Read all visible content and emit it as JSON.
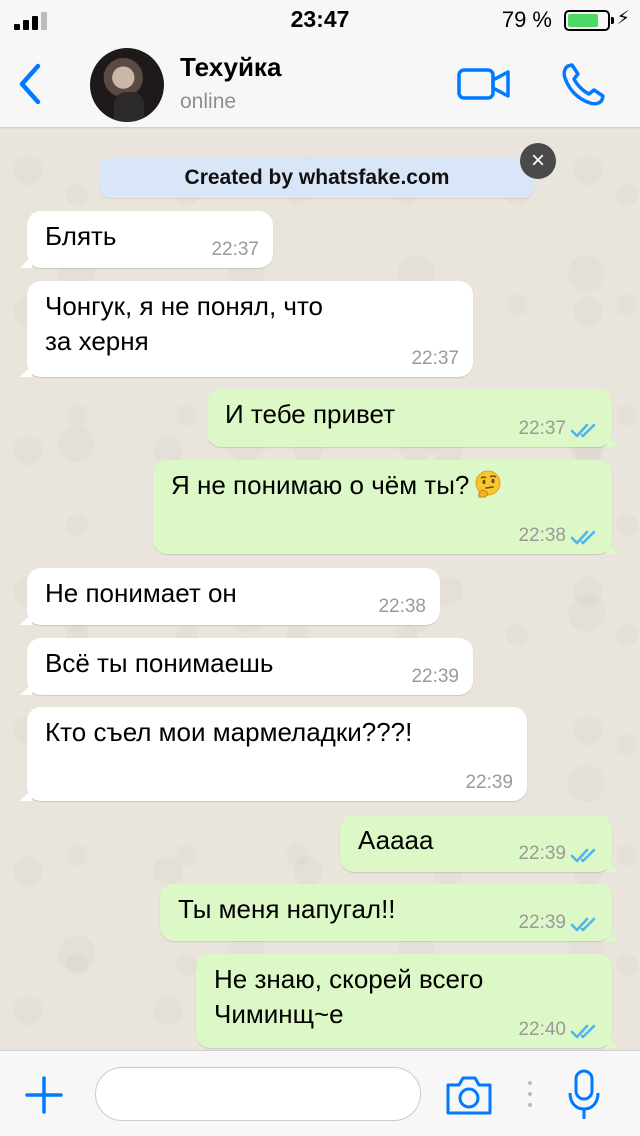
{
  "status_bar": {
    "time": "23:47",
    "battery_percent": "79 %",
    "battery_level": 0.79,
    "signal_bars_filled": 3
  },
  "header": {
    "contact_name": "Техуйка",
    "contact_status": "online",
    "accent_color": "#007aff"
  },
  "banner": {
    "text": "Created by whatsfake.com",
    "close_symbol": "×"
  },
  "messages": [
    {
      "dir": "in",
      "lines": [
        "Блять"
      ],
      "time": "22:37"
    },
    {
      "dir": "in",
      "lines": [
        "Чонгук, я не понял, что",
        "за херня"
      ],
      "time": "22:37"
    },
    {
      "dir": "out",
      "lines": [
        "И тебе привет"
      ],
      "time": "22:37",
      "status": "read"
    },
    {
      "dir": "out",
      "lines": [
        "Я не понимаю о чём ты?"
      ],
      "time": "22:38",
      "status": "read",
      "emoji": "thinking-face"
    },
    {
      "dir": "in",
      "lines": [
        "Не понимает он"
      ],
      "time": "22:38"
    },
    {
      "dir": "in",
      "lines": [
        "Всё ты понимаешь"
      ],
      "time": "22:39"
    },
    {
      "dir": "in",
      "lines": [
        "Кто съел мои мармеладки???!"
      ],
      "time": "22:39"
    },
    {
      "dir": "out",
      "lines": [
        "Ааааа"
      ],
      "time": "22:39",
      "status": "read"
    },
    {
      "dir": "out",
      "lines": [
        "Ты меня напугал!!"
      ],
      "time": "22:39",
      "status": "read"
    },
    {
      "dir": "out",
      "lines": [
        "Не знаю, скорей всего",
        "Чиминщ~е"
      ],
      "time": "22:40",
      "status": "read"
    }
  ],
  "input": {
    "placeholder": ""
  },
  "colors": {
    "incoming_bubble": "#ffffff",
    "outgoing_bubble": "#dcf8c6",
    "read_ticks": "#4fb6ec",
    "icon_blue": "#007aff"
  }
}
